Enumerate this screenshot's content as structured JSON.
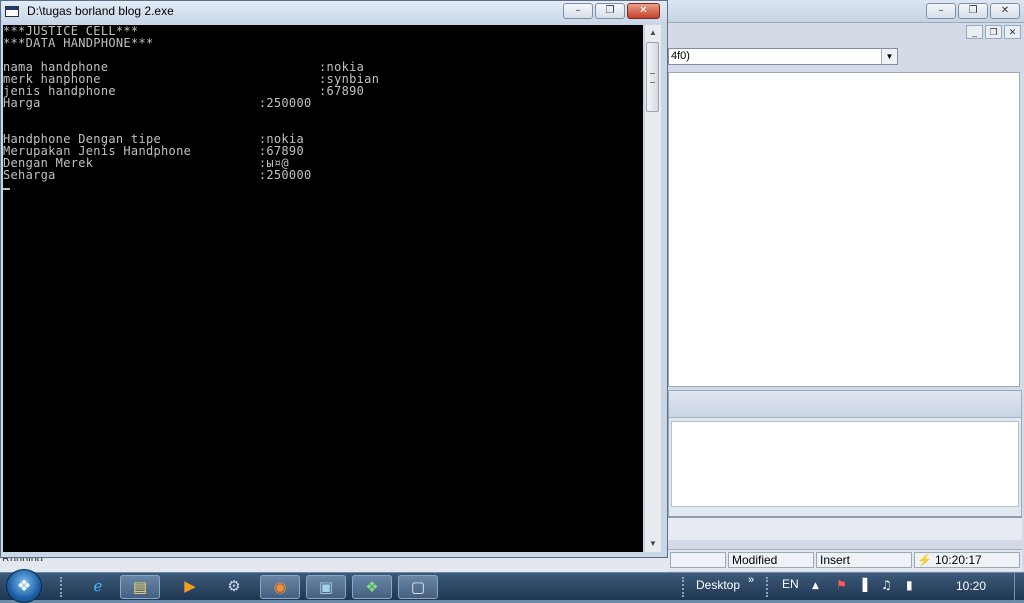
{
  "ide": {
    "combo_value": "4f0)",
    "status": {
      "modified": "Modified",
      "insert": "Insert",
      "time": "10:20:17"
    },
    "left_status": "Running"
  },
  "console": {
    "title": "D:\\tugas borland blog 2.exe",
    "lines": [
      "***JUSTICE CELL***",
      "***DATA HANDPHONE***",
      "",
      "nama handphone                            :nokia",
      "merk hanphone                             :synbian",
      "jenis handphone                           :67890",
      "Harga                             :250000",
      "",
      "",
      "Handphone Dengan tipe             :nokia",
      "Merupakan Jenis Handphone         :67890",
      "Dengan Merek                      :ы¤@",
      "Seharga                           :250000"
    ]
  },
  "taskbar": {
    "desktop_label": "Desktop",
    "chevron": "»",
    "language": "EN",
    "clock": "10:20"
  },
  "icons": {
    "start": "windows-logo-icon",
    "ie": "internet-explorer-icon",
    "explorer": "folder-icon",
    "media": "media-player-icon",
    "tool": "tool-icon",
    "firefox": "firefox-icon",
    "app1": "app-icon",
    "app2": "app-icon",
    "console": "console-icon"
  },
  "colors": {
    "console_bg": "#000000",
    "console_text": "#c0c0c0",
    "close_button": "#c4402a"
  }
}
